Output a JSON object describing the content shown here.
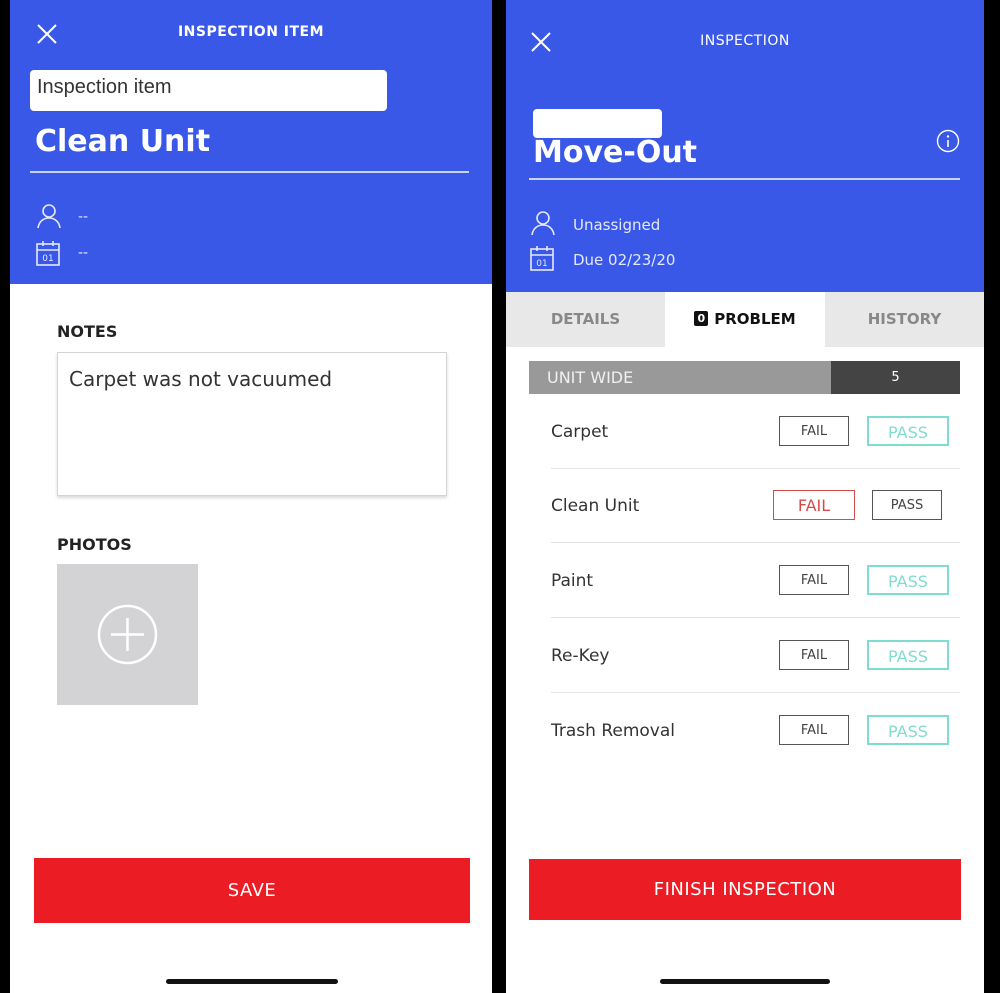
{
  "left_screen": {
    "header_title": "INSPECTION ITEM",
    "label_box_text": "Inspection item",
    "item_title": "Clean Unit",
    "assignee": "--",
    "due_date": "--",
    "notes_label": "NOTES",
    "notes_value": "Carpet was not vacuumed",
    "photos_label": "PHOTOS",
    "save_label": "SAVE"
  },
  "right_screen": {
    "header_title": "INSPECTION",
    "inspection_title": "Move-Out",
    "assignee": "Unassigned",
    "due_date": "Due 02/23/20",
    "tabs": [
      {
        "label": "DETAILS"
      },
      {
        "label": "PROBLEM",
        "count": "0"
      },
      {
        "label": "HISTORY"
      }
    ],
    "section": {
      "name": "UNIT WIDE",
      "count": "5"
    },
    "items": [
      {
        "name": "Carpet",
        "fail_label": "FAIL",
        "pass_label": "PASS",
        "result": "pass"
      },
      {
        "name": "Clean Unit",
        "fail_label": "FAIL",
        "pass_label": "PASS",
        "result": "fail"
      },
      {
        "name": "Paint",
        "fail_label": "FAIL",
        "pass_label": "PASS",
        "result": "pass"
      },
      {
        "name": "Re-Key",
        "fail_label": "FAIL",
        "pass_label": "PASS",
        "result": "pass"
      },
      {
        "name": "Trash Removal",
        "fail_label": "FAIL",
        "pass_label": "PASS",
        "result": "pass"
      }
    ],
    "finish_label": "FINISH INSPECTION"
  },
  "colors": {
    "header_blue": "#3958e8",
    "action_red": "#ec1c24",
    "pass_teal": "#7fdcd0",
    "fail_red": "#d74a4a"
  },
  "icons": [
    "close-icon",
    "user-icon",
    "calendar-icon",
    "plus-circle-icon",
    "info-icon"
  ]
}
